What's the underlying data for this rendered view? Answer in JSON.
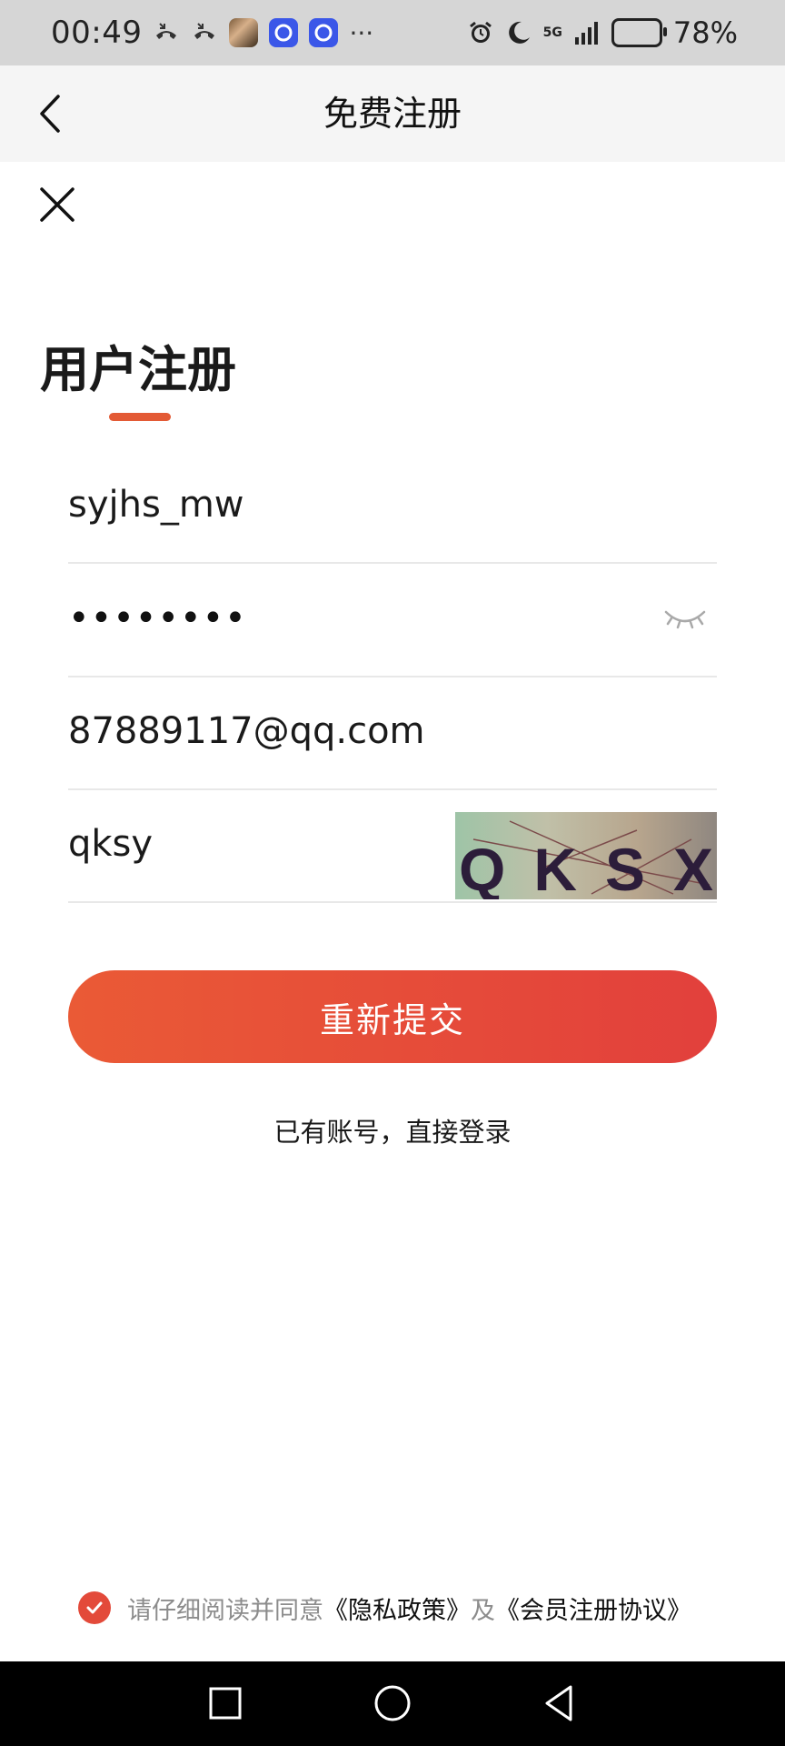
{
  "status_bar": {
    "time": "00:49",
    "battery_percent": "78%",
    "network": "5G",
    "icons": [
      "missed-call-icon",
      "missed-call-icon",
      "app-photo-icon",
      "app-blue-icon",
      "app-blue-icon",
      "more-dots-icon",
      "alarm-icon",
      "moon-icon",
      "signal-icon",
      "battery-icon"
    ]
  },
  "header": {
    "title": "免费注册",
    "back_icon": "chevron-left-icon"
  },
  "page": {
    "close_icon": "close-icon",
    "title": "用户注册"
  },
  "form": {
    "username": "syjhs_mw",
    "password_masked": "••••••••",
    "email": "87889117@qq.com",
    "captcha": "qksy",
    "captcha_image_text": "QKSX",
    "eye_icon": "eye-closed-icon"
  },
  "submit_label": "重新提交",
  "login_link": "已有账号，直接登录",
  "agreement": {
    "checked": true,
    "prefix": "请仔细阅读并同意",
    "privacy_link": "《隐私政策》",
    "and": "及",
    "member_link": "《会员注册协议》"
  },
  "colors": {
    "accent": "#e35a35",
    "button_start": "#ea5a36",
    "button_end": "#e2403c"
  }
}
